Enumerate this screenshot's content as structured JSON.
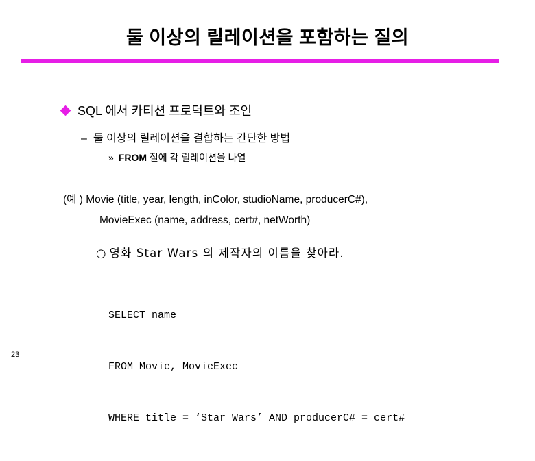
{
  "slide": {
    "title": "둘 이상의 릴레이션을 포함하는 질의",
    "rule_color": "#e61ee6",
    "page_number": "23",
    "bullets": {
      "level1": {
        "marker": "diamond-bullet",
        "text": "SQL 에서 카티션 프로덕트와 조인"
      },
      "level2": {
        "marker": "–",
        "text": "둘 이상의 릴레이션을 결합하는 간단한 방법"
      },
      "level3": {
        "marker": "»",
        "keyword": "FROM",
        "text": " 절에 각 릴레이션을 나열"
      }
    },
    "example": {
      "line1": "(예 ) Movie (title, year, length, inColor, studioName, producerC#),",
      "line2": "MovieExec (name, address, cert#, netWorth)"
    },
    "question": {
      "marker": "○",
      "text": "영화 Star Wars 의 제작자의 이름을 찾아라."
    },
    "sql": {
      "line1": "SELECT name",
      "line2": "FROM Movie, MovieExec",
      "line3": "WHERE title = ‘Star Wars’ AND producerC# = cert#"
    }
  }
}
